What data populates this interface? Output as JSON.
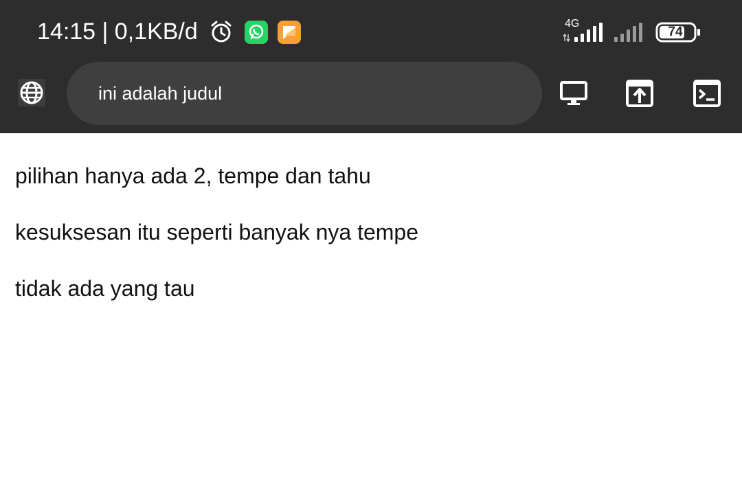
{
  "status_bar": {
    "time_and_speed": "14:15 | 0,1KB/d",
    "network_type": "4G",
    "battery_level": "74",
    "icons": [
      "alarm-icon",
      "whatsapp-icon",
      "message-icon",
      "signal-4g-icon",
      "signal-icon",
      "battery-icon"
    ]
  },
  "toolbar": {
    "title": "ini adalah judul",
    "icons": [
      "globe-icon",
      "desktop-icon",
      "share-icon",
      "console-icon"
    ]
  },
  "content": {
    "lines": [
      "pilihan hanya ada 2, tempe dan tahu",
      "kesuksesan itu seperti banyak nya tempe",
      "tidak ada yang tau"
    ]
  },
  "colors": {
    "bar_background": "#2d2d2d",
    "url_background": "#3f3f3f",
    "whatsapp": "#25d366",
    "message_app": "#f7a035"
  }
}
